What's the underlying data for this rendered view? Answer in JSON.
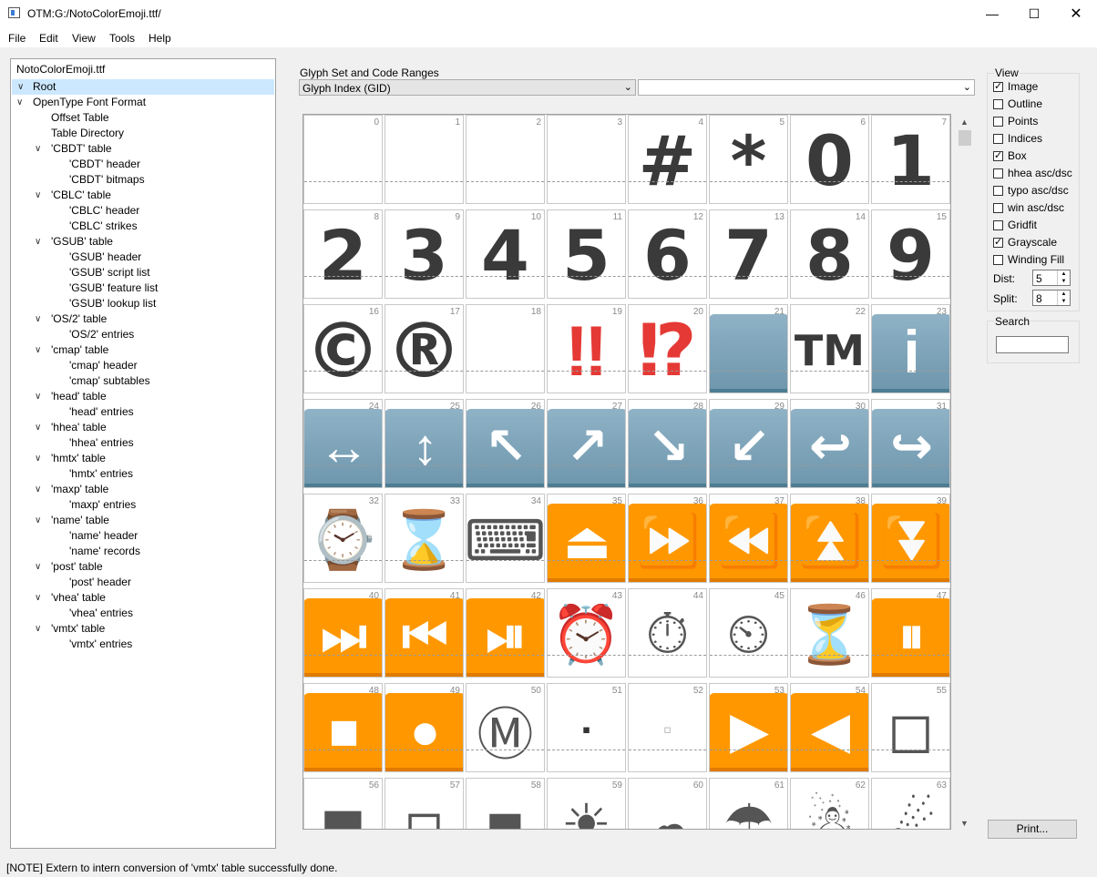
{
  "window": {
    "title": "OTM:G:/NotoColorEmoji.ttf/",
    "minimize_icon": "minimize-icon",
    "maximize_icon": "maximize-icon",
    "close_icon": "close-icon"
  },
  "menu": [
    "File",
    "Edit",
    "View",
    "Tools",
    "Help"
  ],
  "tree": {
    "file": "NotoColorEmoji.ttf",
    "root": "Root",
    "items": [
      {
        "label": "OpenType Font Format",
        "level": 1,
        "expand": true
      },
      {
        "label": "Offset Table",
        "level": 2,
        "expand": false
      },
      {
        "label": "Table Directory",
        "level": 2,
        "expand": false
      },
      {
        "label": "'CBDT' table",
        "level": 2,
        "expand": true
      },
      {
        "label": "'CBDT' header",
        "level": 3,
        "expand": false
      },
      {
        "label": "'CBDT' bitmaps",
        "level": 3,
        "expand": false
      },
      {
        "label": "'CBLC' table",
        "level": 2,
        "expand": true
      },
      {
        "label": "'CBLC' header",
        "level": 3,
        "expand": false
      },
      {
        "label": "'CBLC' strikes",
        "level": 3,
        "expand": false
      },
      {
        "label": "'GSUB' table",
        "level": 2,
        "expand": true
      },
      {
        "label": "'GSUB' header",
        "level": 3,
        "expand": false
      },
      {
        "label": "'GSUB' script list",
        "level": 3,
        "expand": false
      },
      {
        "label": "'GSUB' feature list",
        "level": 3,
        "expand": false
      },
      {
        "label": "'GSUB' lookup list",
        "level": 3,
        "expand": false
      },
      {
        "label": "'OS/2' table",
        "level": 2,
        "expand": true
      },
      {
        "label": "'OS/2' entries",
        "level": 3,
        "expand": false
      },
      {
        "label": "'cmap' table",
        "level": 2,
        "expand": true
      },
      {
        "label": "'cmap' header",
        "level": 3,
        "expand": false
      },
      {
        "label": "'cmap' subtables",
        "level": 3,
        "expand": false
      },
      {
        "label": "'head' table",
        "level": 2,
        "expand": true
      },
      {
        "label": "'head' entries",
        "level": 3,
        "expand": false
      },
      {
        "label": "'hhea' table",
        "level": 2,
        "expand": true
      },
      {
        "label": "'hhea' entries",
        "level": 3,
        "expand": false
      },
      {
        "label": "'hmtx' table",
        "level": 2,
        "expand": true
      },
      {
        "label": "'hmtx' entries",
        "level": 3,
        "expand": false
      },
      {
        "label": "'maxp' table",
        "level": 2,
        "expand": true
      },
      {
        "label": "'maxp' entries",
        "level": 3,
        "expand": false
      },
      {
        "label": "'name' table",
        "level": 2,
        "expand": true
      },
      {
        "label": "'name' header",
        "level": 3,
        "expand": false
      },
      {
        "label": "'name' records",
        "level": 3,
        "expand": false
      },
      {
        "label": "'post' table",
        "level": 2,
        "expand": true
      },
      {
        "label": "'post' header",
        "level": 3,
        "expand": false
      },
      {
        "label": "'vhea' table",
        "level": 2,
        "expand": true
      },
      {
        "label": "'vhea' entries",
        "level": 3,
        "expand": false
      },
      {
        "label": "'vmtx' table",
        "level": 2,
        "expand": true
      },
      {
        "label": "'vmtx' entries",
        "level": 3,
        "expand": false
      }
    ]
  },
  "glyphset": {
    "label": "Glyph Set and Code Ranges",
    "selected": "Glyph Index (GID)",
    "range_value": ""
  },
  "glyphs": [
    {
      "n": "0",
      "k": "empty"
    },
    {
      "n": "1",
      "k": "empty"
    },
    {
      "n": "2",
      "k": "empty"
    },
    {
      "n": "3",
      "k": "empty"
    },
    {
      "n": "4",
      "k": "text",
      "t": "#"
    },
    {
      "n": "5",
      "k": "text",
      "t": "*"
    },
    {
      "n": "6",
      "k": "text",
      "t": "0"
    },
    {
      "n": "7",
      "k": "text",
      "t": "1"
    },
    {
      "n": "8",
      "k": "text",
      "t": "2"
    },
    {
      "n": "9",
      "k": "text",
      "t": "3"
    },
    {
      "n": "10",
      "k": "text",
      "t": "4"
    },
    {
      "n": "11",
      "k": "text",
      "t": "5"
    },
    {
      "n": "12",
      "k": "text",
      "t": "6"
    },
    {
      "n": "13",
      "k": "text",
      "t": "7"
    },
    {
      "n": "14",
      "k": "text",
      "t": "8"
    },
    {
      "n": "15",
      "k": "text",
      "t": "9"
    },
    {
      "n": "16",
      "k": "text",
      "t": "©"
    },
    {
      "n": "17",
      "k": "text",
      "t": "®"
    },
    {
      "n": "18",
      "k": "empty"
    },
    {
      "n": "19",
      "k": "red",
      "t": "‼"
    },
    {
      "n": "20",
      "k": "red",
      "t": "⁉"
    },
    {
      "n": "21",
      "k": "blue",
      "t": ""
    },
    {
      "n": "22",
      "k": "text",
      "t": "TM"
    },
    {
      "n": "23",
      "k": "blue",
      "t": "i"
    },
    {
      "n": "24",
      "k": "blue",
      "t": "↔"
    },
    {
      "n": "25",
      "k": "blue",
      "t": "↕"
    },
    {
      "n": "26",
      "k": "blue",
      "t": "↖"
    },
    {
      "n": "27",
      "k": "blue",
      "t": "↗"
    },
    {
      "n": "28",
      "k": "blue",
      "t": "↘"
    },
    {
      "n": "29",
      "k": "blue",
      "t": "↙"
    },
    {
      "n": "30",
      "k": "blue",
      "t": "↩"
    },
    {
      "n": "31",
      "k": "blue",
      "t": "↪"
    },
    {
      "n": "32",
      "k": "emoji",
      "t": "⌚"
    },
    {
      "n": "33",
      "k": "emoji",
      "t": "⌛"
    },
    {
      "n": "34",
      "k": "emoji",
      "t": "⌨"
    },
    {
      "n": "35",
      "k": "orange",
      "t": "⏏"
    },
    {
      "n": "36",
      "k": "orange",
      "t": "⏩"
    },
    {
      "n": "37",
      "k": "orange",
      "t": "⏪"
    },
    {
      "n": "38",
      "k": "orange",
      "t": "⏫"
    },
    {
      "n": "39",
      "k": "orange",
      "t": "⏬"
    },
    {
      "n": "40",
      "k": "orange",
      "t": "⏭"
    },
    {
      "n": "41",
      "k": "orange",
      "t": "⏮"
    },
    {
      "n": "42",
      "k": "orange",
      "t": "⏯"
    },
    {
      "n": "43",
      "k": "emoji",
      "t": "⏰"
    },
    {
      "n": "44",
      "k": "emoji",
      "t": "⏱"
    },
    {
      "n": "45",
      "k": "emoji",
      "t": "⏲"
    },
    {
      "n": "46",
      "k": "emoji",
      "t": "⏳"
    },
    {
      "n": "47",
      "k": "orange",
      "t": "⏸"
    },
    {
      "n": "48",
      "k": "orange",
      "t": "■"
    },
    {
      "n": "49",
      "k": "orange",
      "t": "●"
    },
    {
      "n": "50",
      "k": "emoji",
      "t": "Ⓜ"
    },
    {
      "n": "51",
      "k": "small",
      "t": "▪"
    },
    {
      "n": "52",
      "k": "small",
      "t": "▫"
    },
    {
      "n": "53",
      "k": "orange",
      "t": "▶"
    },
    {
      "n": "54",
      "k": "orange",
      "t": "◀"
    },
    {
      "n": "55",
      "k": "emoji",
      "t": "◻"
    },
    {
      "n": "56",
      "k": "emoji",
      "t": "◼"
    },
    {
      "n": "57",
      "k": "emoji",
      "t": "◽"
    },
    {
      "n": "58",
      "k": "emoji",
      "t": "◾"
    },
    {
      "n": "59",
      "k": "emoji",
      "t": "☀"
    },
    {
      "n": "60",
      "k": "emoji",
      "t": "☁"
    },
    {
      "n": "61",
      "k": "emoji",
      "t": "☂"
    },
    {
      "n": "62",
      "k": "emoji",
      "t": "☃"
    },
    {
      "n": "63",
      "k": "emoji",
      "t": "☄"
    }
  ],
  "view": {
    "title": "View",
    "options": [
      {
        "label": "Image",
        "checked": true
      },
      {
        "label": "Outline",
        "checked": false
      },
      {
        "label": "Points",
        "checked": false
      },
      {
        "label": "Indices",
        "checked": false
      },
      {
        "label": "Box",
        "checked": true
      },
      {
        "label": "hhea asc/dsc",
        "checked": false
      },
      {
        "label": "typo asc/dsc",
        "checked": false
      },
      {
        "label": "win asc/dsc",
        "checked": false
      },
      {
        "label": "Gridfit",
        "checked": false
      },
      {
        "label": "Grayscale",
        "checked": true
      },
      {
        "label": "Winding Fill",
        "checked": false
      }
    ],
    "dist_label": "Dist:",
    "dist_value": "5",
    "split_label": "Split:",
    "split_value": "8"
  },
  "search": {
    "title": "Search",
    "value": ""
  },
  "print_label": "Print...",
  "status": "[NOTE] Extern to intern conversion of 'vmtx' table successfully done."
}
